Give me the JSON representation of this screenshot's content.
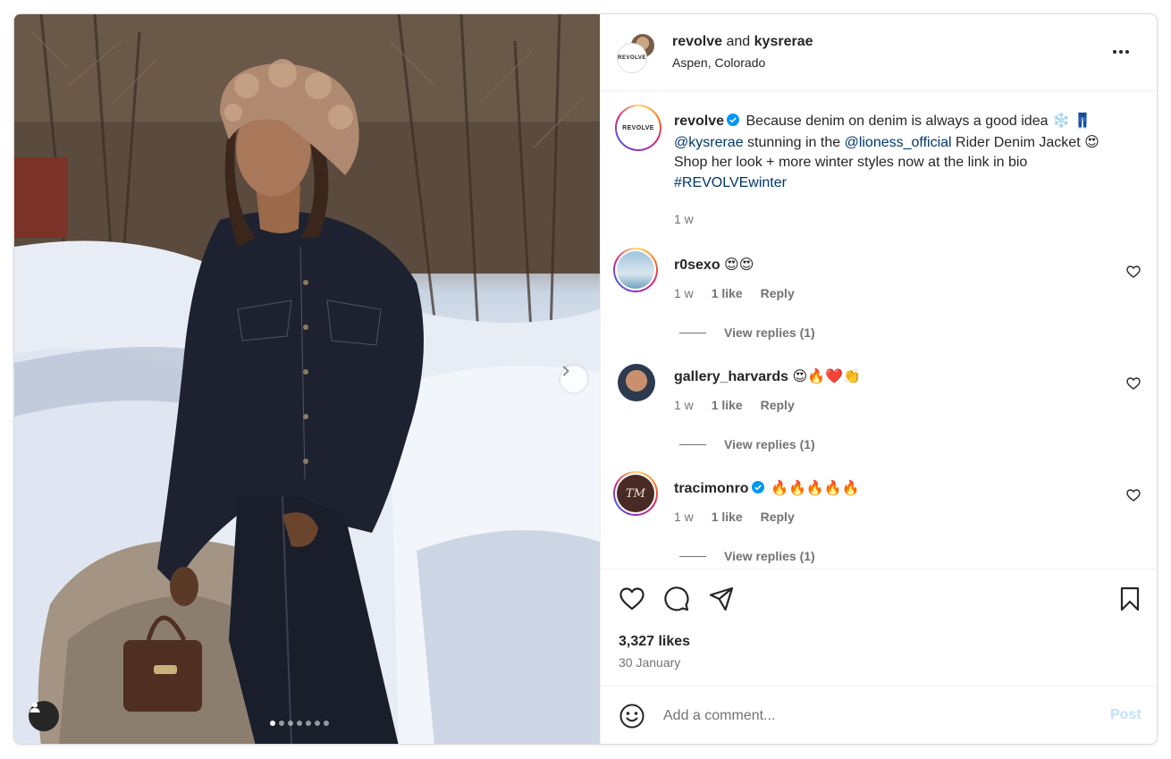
{
  "header": {
    "account_primary": "revolve",
    "connector": "and",
    "account_secondary": "kysrerae",
    "location": "Aspen, Colorado",
    "brand_avatar_text": "REVOLVE"
  },
  "caption": {
    "username": "revolve",
    "text_1": "Because denim on denim is always a good idea",
    "emoji_1": "❄️",
    "emoji_2": "👖",
    "mention_1": "@kysrerae",
    "text_2": "stunning in the",
    "mention_2": "@lioness_official",
    "text_3": "Rider Denim Jacket",
    "emoji_3": "😍",
    "text_4": "Shop her look + more winter styles now at the link in bio",
    "hashtag": "#REVOLVEwinter",
    "age": "1 w",
    "avatar_text": "REVOLVE"
  },
  "comments": [
    {
      "username": "r0sexo",
      "emojis": "😍😍",
      "age": "1 w",
      "likes": "1 like",
      "reply": "Reply",
      "view_replies": "View replies (1)"
    },
    {
      "username": "gallery_harvards",
      "emojis": "😍🔥❤️👏",
      "age": "1 w",
      "likes": "1 like",
      "reply": "Reply",
      "view_replies": "View replies (1)"
    },
    {
      "username": "tracimonro",
      "emojis": "🔥🔥🔥🔥🔥",
      "age": "1 w",
      "likes": "1 like",
      "reply": "Reply",
      "view_replies": "View replies (1)",
      "avatar_text": "TM"
    }
  ],
  "stats": {
    "likes": "3,327 likes",
    "date": "30 January"
  },
  "composer": {
    "placeholder": "Add a comment...",
    "post_label": "Post"
  },
  "carousel": {
    "total_slides": 7,
    "active_slide": 1
  },
  "colors": {
    "link": "#00376b",
    "verified": "#0095f6",
    "muted_text": "#737373",
    "post_disabled": "#c0dffd"
  },
  "icons": [
    "more-options-icon",
    "verified-badge-icon",
    "heart-icon",
    "comment-icon",
    "share-icon",
    "save-icon",
    "emoji-icon",
    "chevron-right-icon",
    "user-tag-icon"
  ]
}
